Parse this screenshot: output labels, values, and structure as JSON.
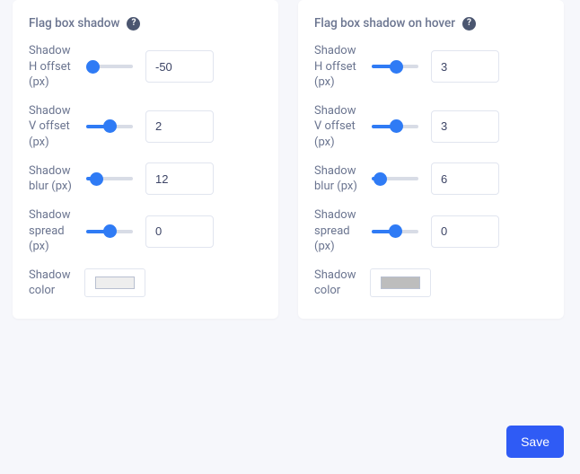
{
  "panels": {
    "base": {
      "title": "Flag box shadow",
      "help_icon": "?",
      "fields": {
        "h_offset": {
          "label": "Shadow H offset (px)",
          "value": "-50",
          "min": -50,
          "max": 50
        },
        "v_offset": {
          "label": "Shadow V offset (px)",
          "value": "2",
          "min": -50,
          "max": 50
        },
        "blur": {
          "label": "Shadow blur (px)",
          "value": "12",
          "min": 0,
          "max": 100
        },
        "spread": {
          "label": "Shadow spread (px)",
          "value": "0",
          "min": -50,
          "max": 50
        },
        "color": {
          "label": "Shadow color",
          "value": "#eeeeee"
        }
      }
    },
    "hover": {
      "title": "Flag box shadow on hover",
      "help_icon": "?",
      "fields": {
        "h_offset": {
          "label": "Shadow H offset (px)",
          "value": "3",
          "min": -50,
          "max": 50
        },
        "v_offset": {
          "label": "Shadow V offset (px)",
          "value": "3",
          "min": -50,
          "max": 50
        },
        "blur": {
          "label": "Shadow blur (px)",
          "value": "6",
          "min": 0,
          "max": 100
        },
        "spread": {
          "label": "Shadow spread (px)",
          "value": "0",
          "min": -50,
          "max": 50
        },
        "color": {
          "label": "Shadow color",
          "value": "#bdbdbd"
        }
      }
    }
  },
  "actions": {
    "save_label": "Save"
  }
}
